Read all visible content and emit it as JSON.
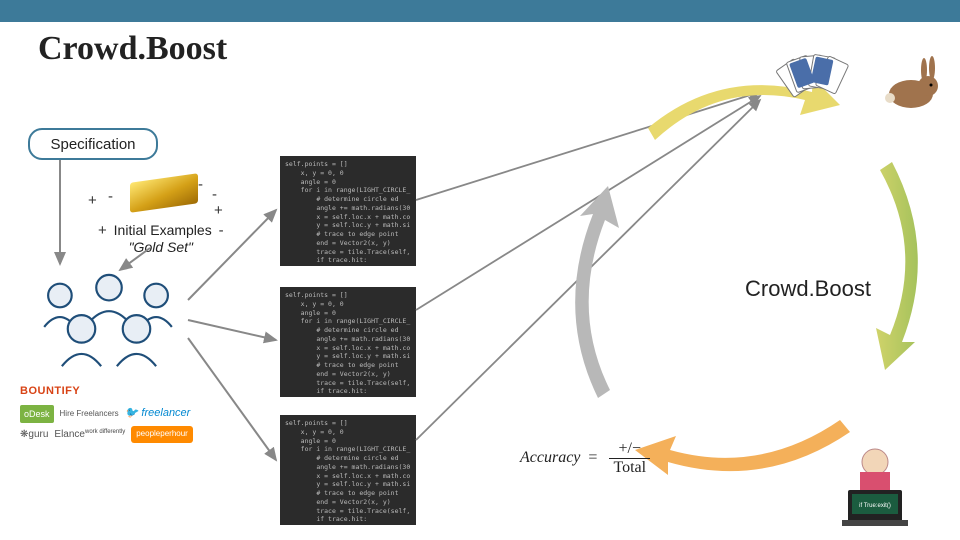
{
  "header": {
    "title": "Crowd.Boost"
  },
  "spec": {
    "label": "Specification"
  },
  "gold": {
    "plus1": "+",
    "minus1": "-",
    "minus2": "-",
    "minus3": "-",
    "plus2": "+",
    "plus3": "+",
    "minus4": "-",
    "caption_line1": "Initial Examples",
    "caption_line2": "\"Gold Set\""
  },
  "logos": {
    "bountify": "BOUNTIFY",
    "odesk": "oDesk",
    "hirefreelancers": "Hire Freelancers",
    "freelancer": "freelancer",
    "guru": "guru",
    "elance": "Elance",
    "elance_sub": "work differently",
    "pph": "peopleperhour"
  },
  "code_sample": "self.points = []\n    x, y = 0, 0\n    angle = 0\n    for i in range(LIGHT_CIRCLE_\n        # determine circle ed\n        angle += math.radians(30\n        x = self.loc.x + math.co\n        y = self.loc.y + math.si\n        # trace to edge point\n        end = Vector2(x, y)\n        trace = tile.Trace(self,\n        if trace.hit:\n            self.points.append(t",
  "label_center": "Crowd.Boost",
  "formula": {
    "lhs": "Accuracy",
    "eq": "=",
    "num": "+/−",
    "den": "Total"
  }
}
